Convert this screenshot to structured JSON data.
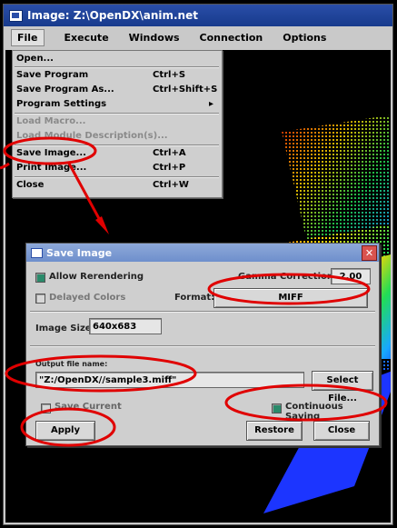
{
  "window": {
    "title": "Image: Z:\\OpenDX\\anim.net"
  },
  "menubar": {
    "items": [
      "File",
      "Execute",
      "Windows",
      "Connection",
      "Options"
    ]
  },
  "file_menu": {
    "items": [
      {
        "label": "Open...",
        "shortcut": ""
      },
      {
        "label": "Save Program",
        "shortcut": "Ctrl+S"
      },
      {
        "label": "Save Program As...",
        "shortcut": "Ctrl+Shift+S"
      },
      {
        "label": "Program Settings",
        "shortcut": ""
      },
      {
        "label": "Load Macro...",
        "shortcut": ""
      },
      {
        "label": "Load Module Description(s)...",
        "shortcut": ""
      },
      {
        "label": "Save Image...",
        "shortcut": "Ctrl+A"
      },
      {
        "label": "Print Image...",
        "shortcut": "Ctrl+P"
      },
      {
        "label": "Close",
        "shortcut": "Ctrl+W"
      }
    ]
  },
  "dialog": {
    "title": "Save Image",
    "close_glyph": "✕",
    "allow_rerendering": "Allow Rerendering",
    "delayed_colors": "Delayed Colors",
    "gamma_label": "Gamma Correction:",
    "gamma_value": "2.00",
    "format_label": "Format:",
    "format_value": "MIFF",
    "image_size_label": "Image Size:",
    "image_size_value": "640x683",
    "output_label": "Output file name:",
    "output_value": "\"Z:/OpenDX//sample3.miff\"",
    "select_file": "Select File...",
    "save_current": "Save Current",
    "continuous_saving": "Continuous Saving",
    "apply": "Apply",
    "restore": "Restore",
    "close": "Close"
  },
  "colors": {
    "annotation": "#e00000",
    "title_blue": "#1f4599"
  }
}
